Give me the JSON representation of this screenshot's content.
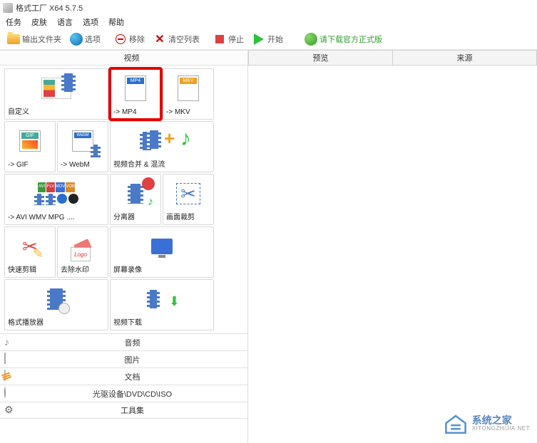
{
  "title": "格式工厂 X64 5.7.5",
  "menu": [
    "任务",
    "皮肤",
    "语言",
    "选项",
    "帮助"
  ],
  "toolbar": {
    "output_folder": "输出文件夹",
    "options": "选项",
    "remove": "移除",
    "clear_list": "清空列表",
    "stop": "停止",
    "start": "开始",
    "download_official": "请下载官方正式版"
  },
  "sections": {
    "video": "视频"
  },
  "tiles": {
    "custom": "自定义",
    "mp4": "-> MP4",
    "mkv": "-> MKV",
    "gif": "-> GIF",
    "webm": "-> WebM",
    "merge": "视频合并 & 混流",
    "avi": "-> AVI WMV MPG ....",
    "splitter": "分离器",
    "crop": "画面裁剪",
    "quickcut": "快速剪辑",
    "remove_wm": "去除水印",
    "screenrec": "屏幕录像",
    "player": "格式播放器",
    "download": "视频下载"
  },
  "categories": {
    "audio": "音频",
    "picture": "图片",
    "document": "文档",
    "disc": "光驱设备\\DVD\\CD\\ISO",
    "tools": "工具集"
  },
  "right_tabs": {
    "preview": "预览",
    "source": "来源"
  },
  "watermark": {
    "main": "系统之家",
    "sub": "XITONGZHIJIA.NET"
  },
  "badges": {
    "avi": "AVI",
    "flv": "FLV",
    "mov": "MOV",
    "vob": "VOB"
  }
}
